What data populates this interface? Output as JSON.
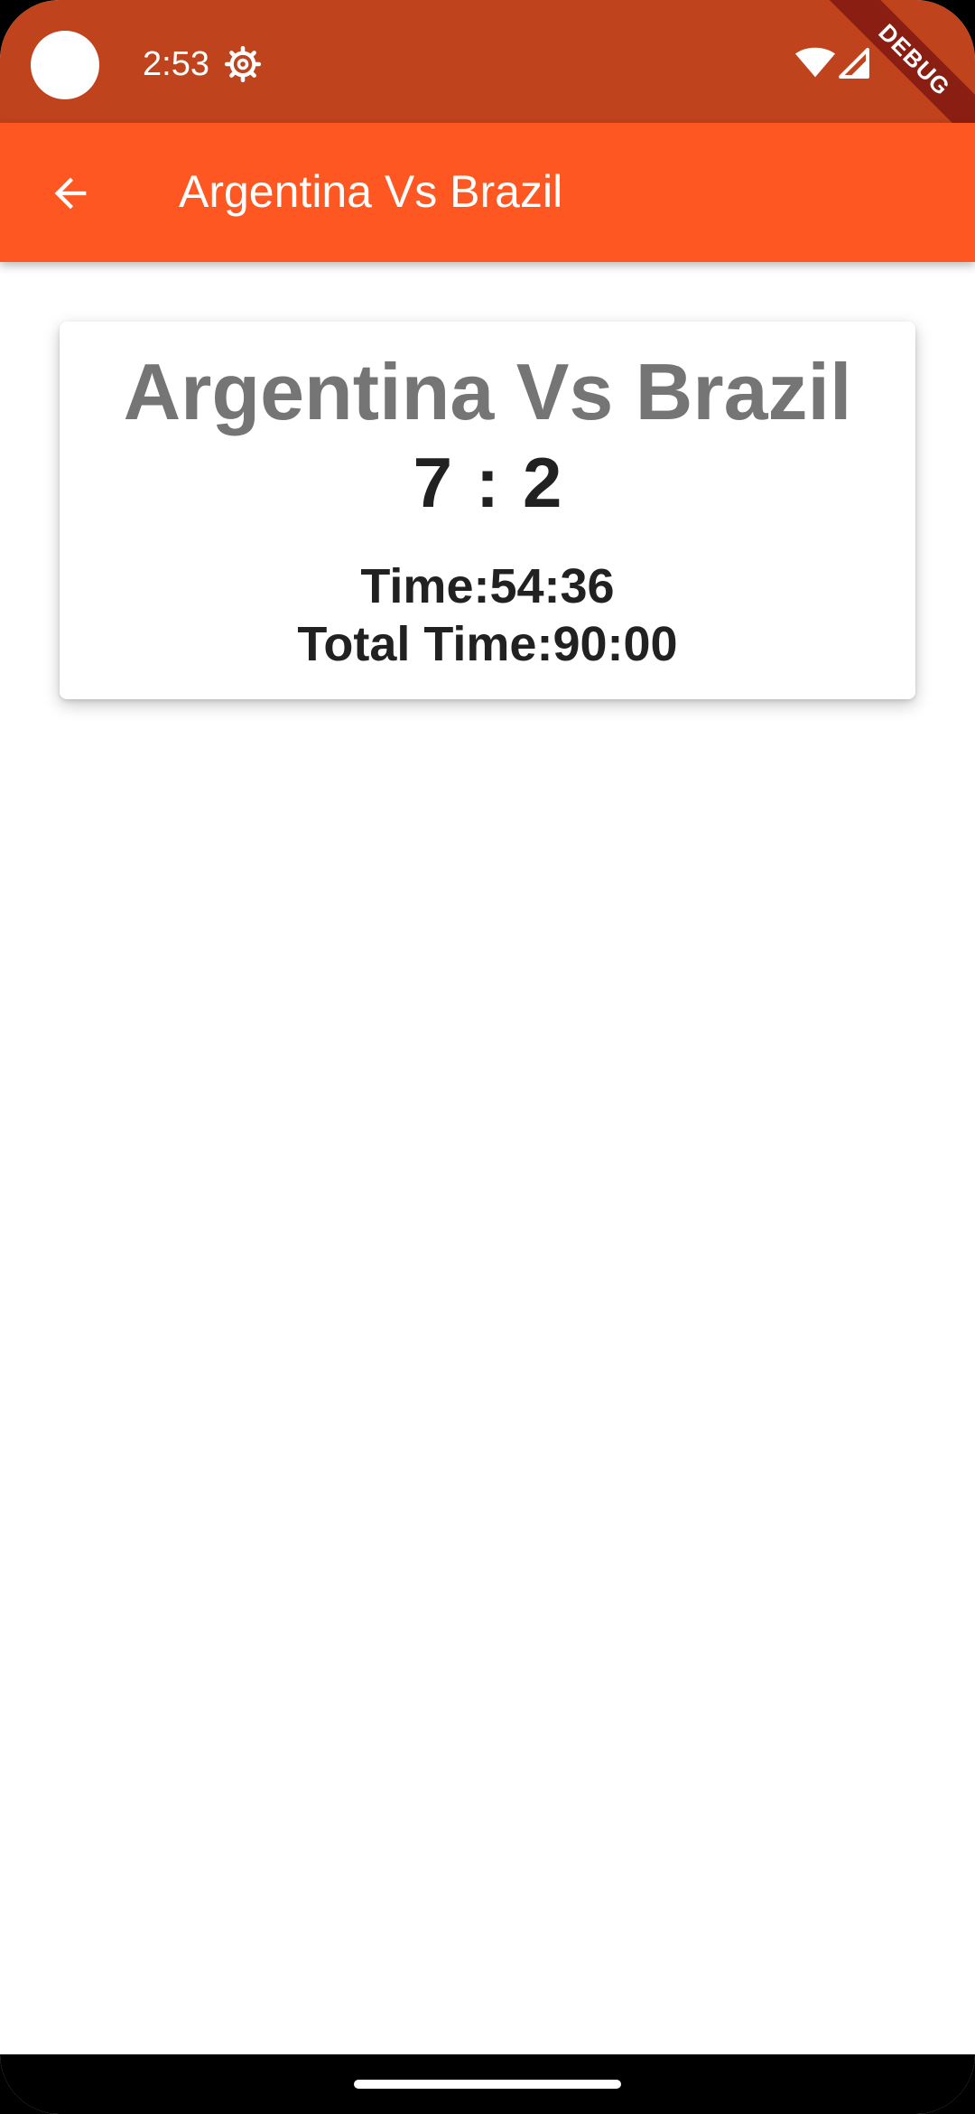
{
  "status_bar": {
    "time": "2:53",
    "icons": [
      "gear-icon",
      "wifi-icon",
      "signal-icon"
    ],
    "background": "#bf431c"
  },
  "debug_banner": "DEBUG",
  "app_bar": {
    "title": "Argentina Vs Brazil",
    "back_icon": "arrow-back-icon",
    "background": "#ff5722"
  },
  "match": {
    "title": "Argentina Vs Brazil",
    "home_score": "7",
    "separator": ":",
    "away_score": "2",
    "time": "Time:54:36",
    "total_time": "Total Time:90:00"
  }
}
